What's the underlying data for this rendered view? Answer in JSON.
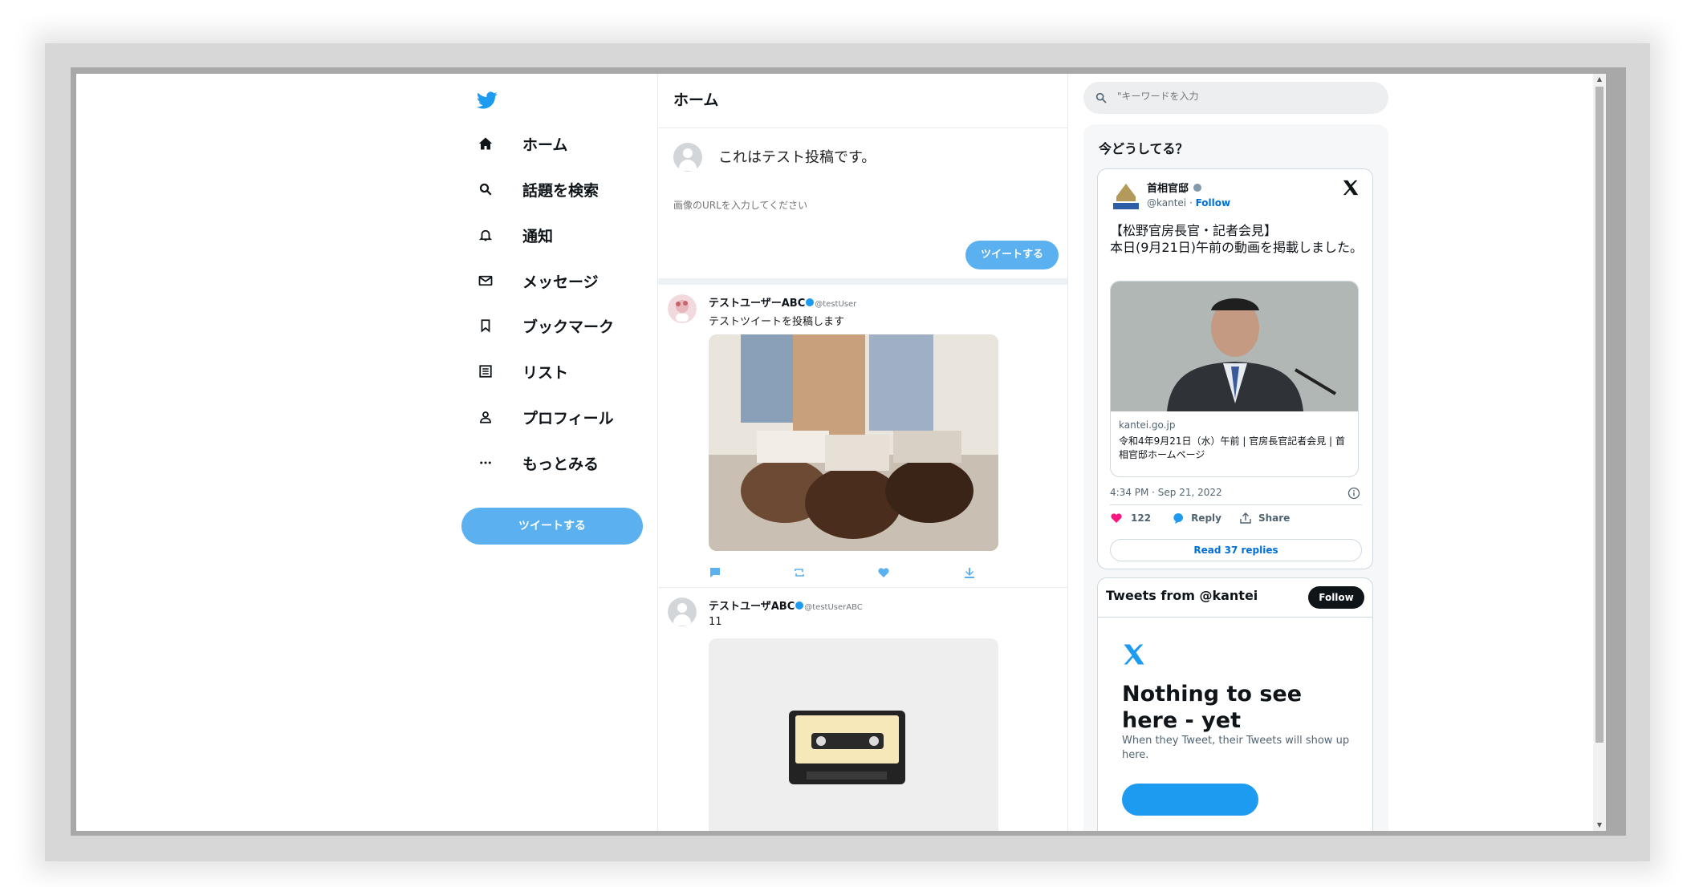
{
  "nav": {
    "items": [
      {
        "label": "ホーム"
      },
      {
        "label": "話題を検索"
      },
      {
        "label": "通知"
      },
      {
        "label": "メッセージ"
      },
      {
        "label": "ブックマーク"
      },
      {
        "label": "リスト"
      },
      {
        "label": "プロフィール"
      },
      {
        "label": "もっとみる"
      }
    ],
    "tweet_button": "ツイートする"
  },
  "main": {
    "title": "ホーム",
    "composer": {
      "text": "これはテスト投稿です。",
      "url_placeholder": "画像のURLを入力してください",
      "submit": "ツイートする"
    },
    "tweets": [
      {
        "name": "テストユーザーABC",
        "handle": "@testUser",
        "text": "テストツイートを投稿します"
      },
      {
        "name": "テストユーザABC",
        "handle": "@testUserABC",
        "text": "11"
      }
    ]
  },
  "search": {
    "placeholder": "\"キーワードを入力"
  },
  "trends": {
    "title": "今どうしてる？"
  },
  "embed": {
    "name": "首相官邸",
    "handle": "@kantei",
    "follow": "Follow",
    "text_line1": "【松野官房長官・記者会見】",
    "text_line2": "本日(9月21日)午前の動画を掲載しました。",
    "card_domain": "kantei.go.jp",
    "card_title": "令和4年9月21日（水）午前 | 官房長官記者会見 | 首相官邸ホームページ",
    "timestamp": "4:34 PM · Sep 21, 2022",
    "likes": "122",
    "reply": "Reply",
    "share": "Share",
    "read_replies": "Read 37 replies"
  },
  "timeline": {
    "title": "Tweets from @kantei",
    "follow": "Follow",
    "empty_title": "Nothing to see here - yet",
    "empty_body": "When they Tweet, their Tweets will show up here."
  },
  "colors": {
    "accent": "#5bb1ef",
    "twitter_blue": "#1d9bf0",
    "like": "#f91880"
  }
}
